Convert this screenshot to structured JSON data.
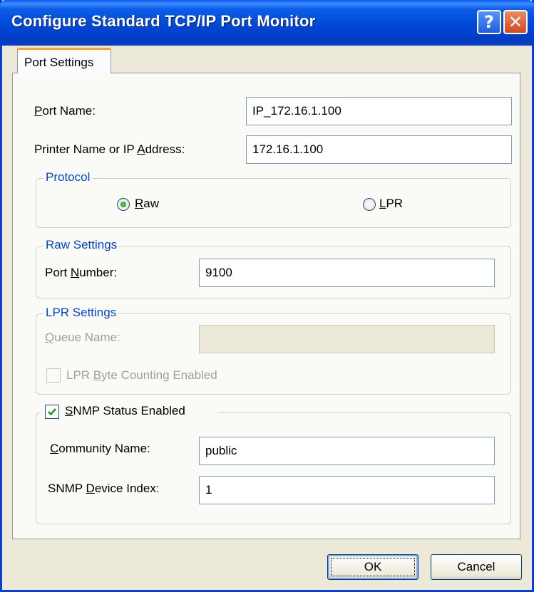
{
  "window": {
    "title": "Configure Standard TCP/IP Port Monitor",
    "help_glyph": "?",
    "close_glyph": "✕"
  },
  "tab": {
    "label": "Port Settings"
  },
  "fields": {
    "port_name": {
      "label_pre": "",
      "label_u": "P",
      "label_post": "ort Name:",
      "value": "IP_172.16.1.100"
    },
    "printer_name": {
      "label_pre": "Printer Name or IP ",
      "label_u": "A",
      "label_post": "ddress:",
      "value": "172.16.1.100"
    }
  },
  "protocol": {
    "legend": "Protocol",
    "raw": {
      "label_u": "R",
      "label_post": "aw",
      "selected": true
    },
    "lpr": {
      "label_u": "L",
      "label_post": "PR",
      "selected": false
    }
  },
  "raw_settings": {
    "legend": "Raw Settings",
    "port_number": {
      "label_pre": "Port ",
      "label_u": "N",
      "label_post": "umber:",
      "value": "9100"
    }
  },
  "lpr_settings": {
    "legend": "LPR Settings",
    "queue_name": {
      "label_u": "Q",
      "label_post": "ueue Name:",
      "value": ""
    },
    "byte_counting": {
      "label_pre": "LPR ",
      "label_u": "B",
      "label_post": "yte Counting Enabled",
      "checked": false,
      "enabled": false
    }
  },
  "snmp": {
    "status": {
      "label_u": "S",
      "label_post": "NMP Status Enabled",
      "checked": true
    },
    "community": {
      "label_u": "C",
      "label_post": "ommunity Name:",
      "value": "public"
    },
    "device_index": {
      "label_pre": "SNMP ",
      "label_u": "D",
      "label_post": "evice Index:",
      "value": "1"
    }
  },
  "buttons": {
    "ok": "OK",
    "cancel": "Cancel"
  },
  "colors": {
    "title_bar": "#0054e3",
    "group_legend": "#0046d5",
    "tab_accent": "#f3a531"
  }
}
